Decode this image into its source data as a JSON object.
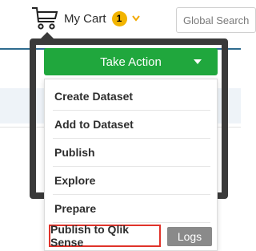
{
  "header": {
    "cart_label": "My Cart",
    "cart_count": "1",
    "search_placeholder": "Global Search"
  },
  "take_action": {
    "label": "Take Action"
  },
  "menu": {
    "items": [
      {
        "label": "Create Dataset"
      },
      {
        "label": "Add to Dataset"
      },
      {
        "label": "Publish"
      },
      {
        "label": "Explore"
      },
      {
        "label": "Prepare"
      }
    ],
    "publish_qlik_label": "Publish to Qlik Sense",
    "logs_label": "Logs"
  },
  "colors": {
    "take_action_bg": "#20a73d",
    "badge_bg": "#f2b400",
    "highlight_border": "#e0332a",
    "frame": "#3a3a3a",
    "logs_bg": "#8a8a8a"
  },
  "icons": [
    "cart-icon",
    "chevron-down-icon",
    "caret-down-icon"
  ]
}
